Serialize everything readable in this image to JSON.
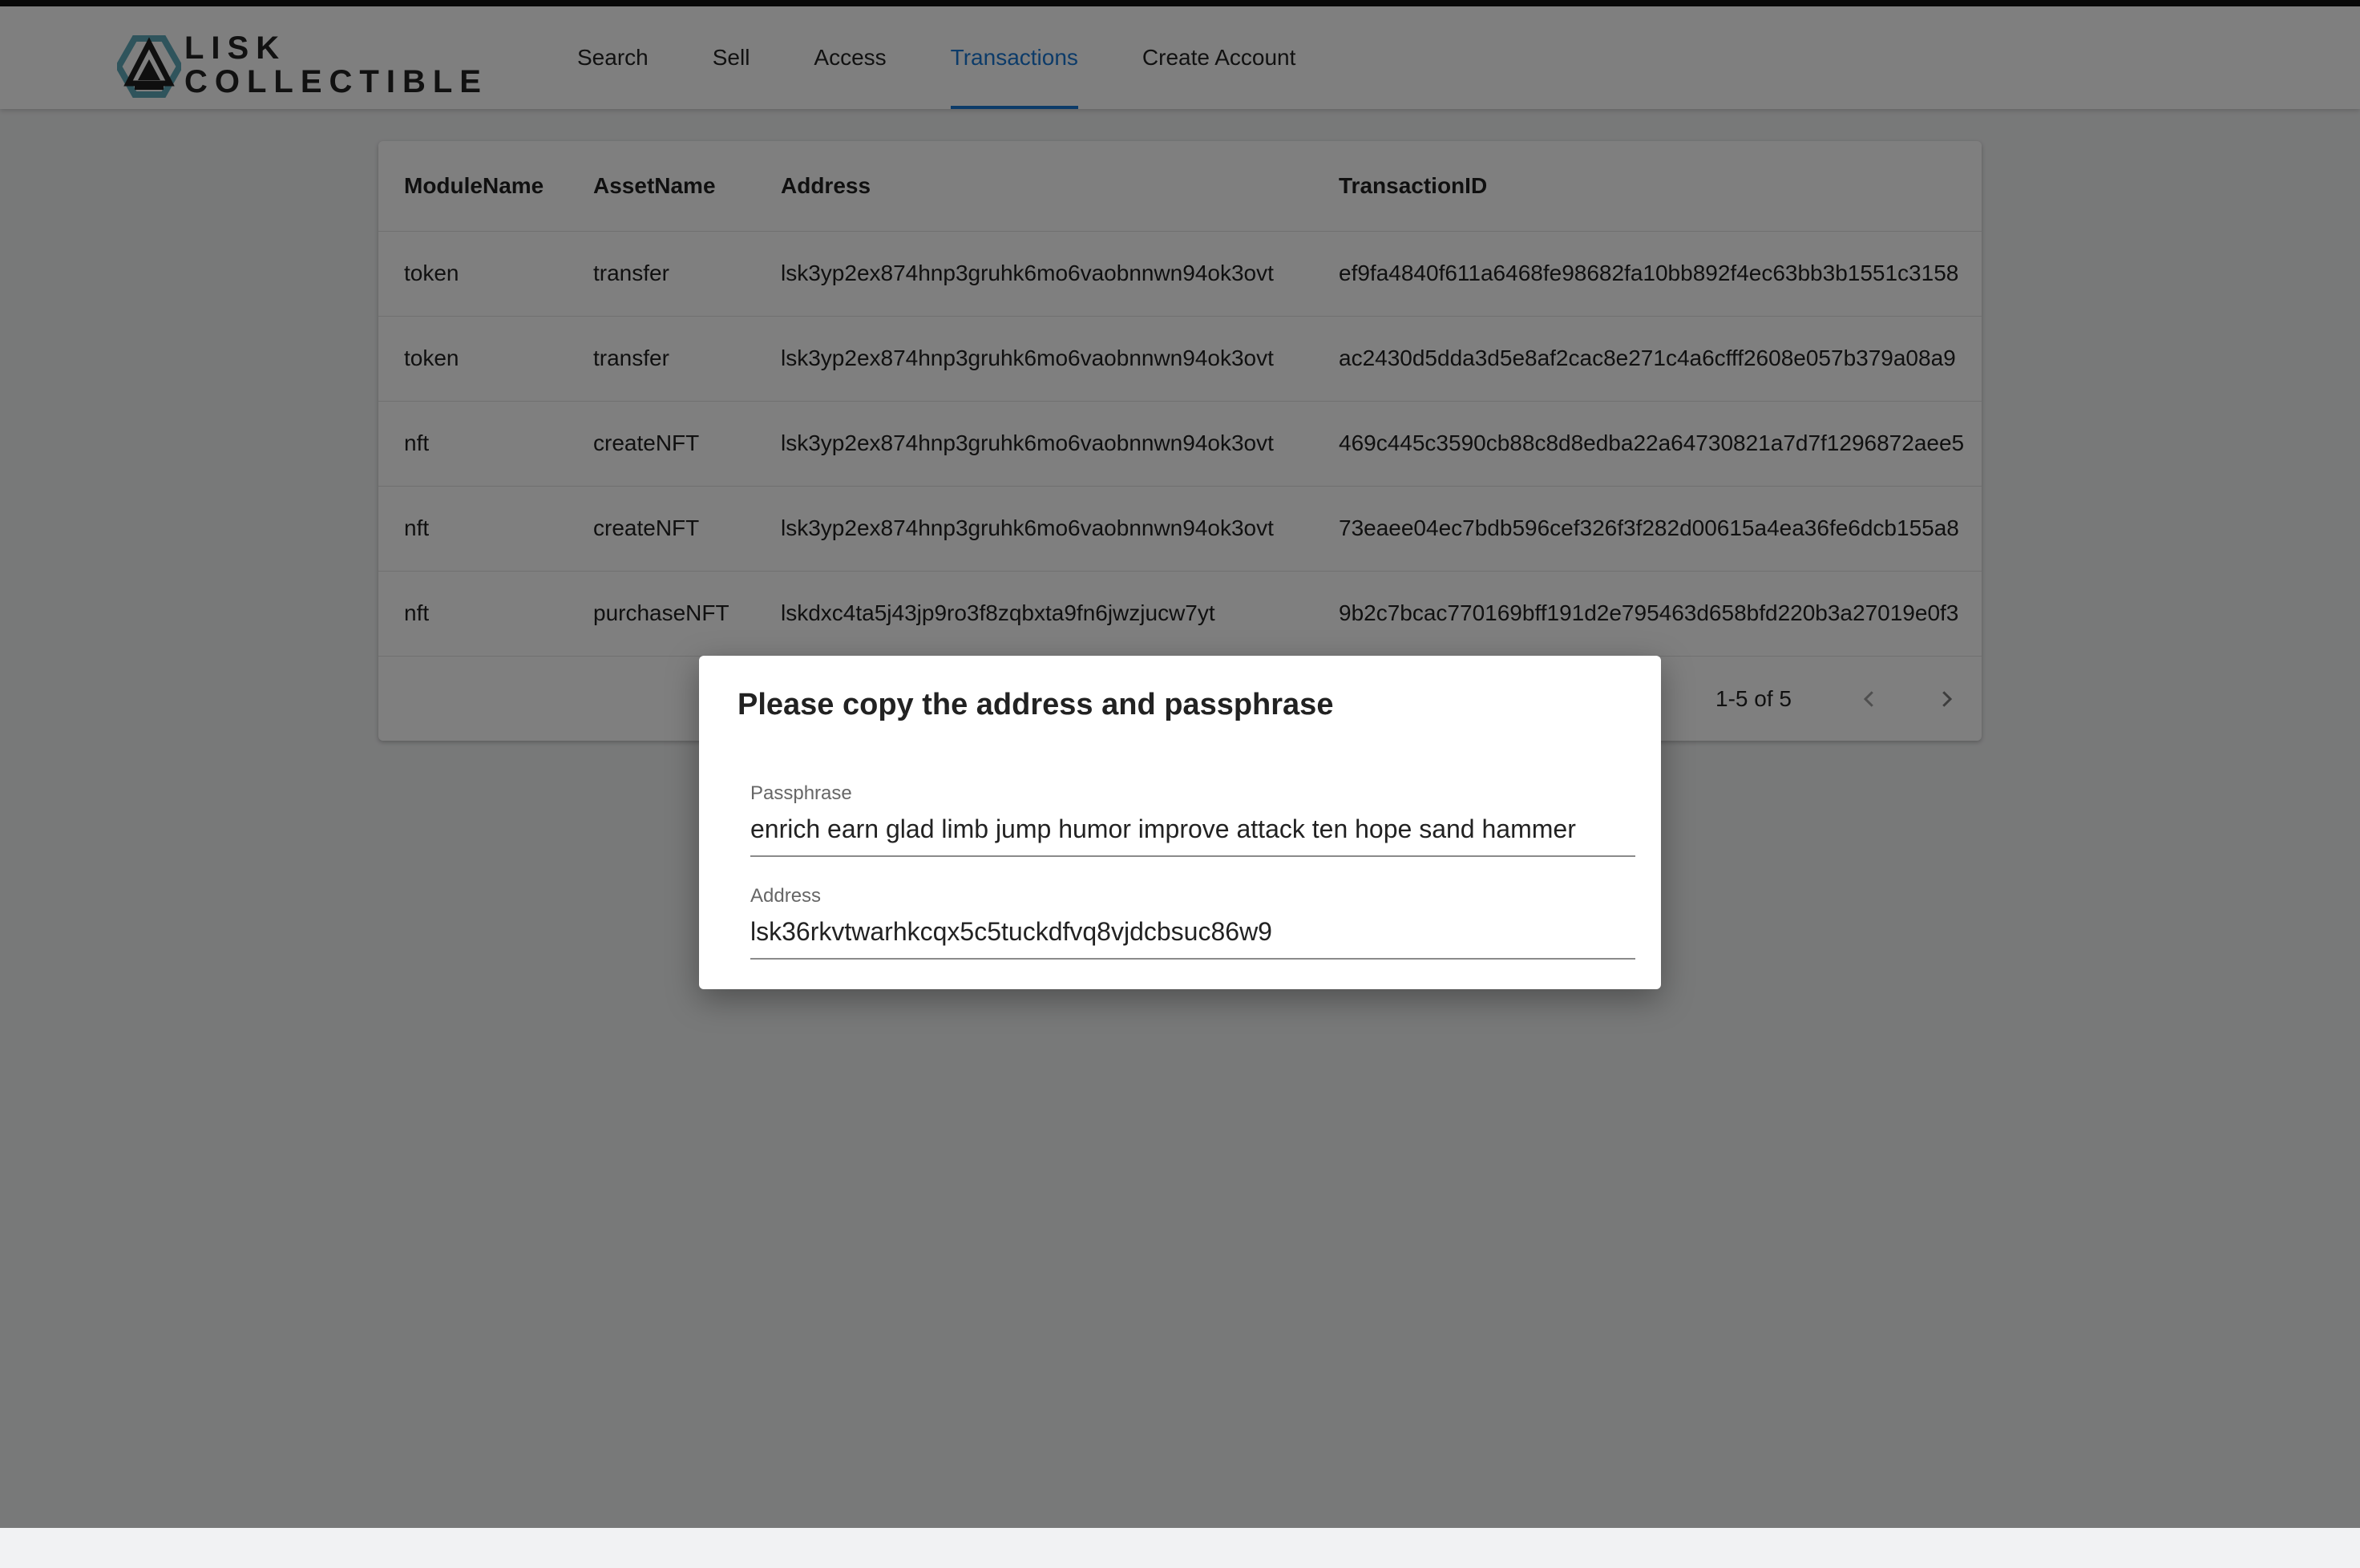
{
  "logo": {
    "line1": "LISK",
    "line2": "COLLECTIBLE",
    "icon": "lisk-logo-icon"
  },
  "nav": {
    "tabs": [
      {
        "label": "Search"
      },
      {
        "label": "Sell"
      },
      {
        "label": "Access"
      },
      {
        "label": "Transactions",
        "active": true
      },
      {
        "label": "Create Account"
      }
    ],
    "accent_color": "#1976d2"
  },
  "table": {
    "columns": [
      "ModuleName",
      "AssetName",
      "Address",
      "TransactionID"
    ],
    "rows": [
      {
        "module": "token",
        "asset": "transfer",
        "address": "lsk3yp2ex874hnp3gruhk6mo6vaobnnwn94ok3ovt",
        "txid": "ef9fa4840f611a6468fe98682fa10bb892f4ec63bb3b1551c3158"
      },
      {
        "module": "token",
        "asset": "transfer",
        "address": "lsk3yp2ex874hnp3gruhk6mo6vaobnnwn94ok3ovt",
        "txid": "ac2430d5dda3d5e8af2cac8e271c4a6cfff2608e057b379a08a9"
      },
      {
        "module": "nft",
        "asset": "createNFT",
        "address": "lsk3yp2ex874hnp3gruhk6mo6vaobnnwn94ok3ovt",
        "txid": "469c445c3590cb88c8d8edba22a64730821a7d7f1296872aee5"
      },
      {
        "module": "nft",
        "asset": "createNFT",
        "address": "lsk3yp2ex874hnp3gruhk6mo6vaobnnwn94ok3ovt",
        "txid": "73eaee04ec7bdb596cef326f3f282d00615a4ea36fe6dcb155a8"
      },
      {
        "module": "nft",
        "asset": "purchaseNFT",
        "address": "lskdxc4ta5j43jp9ro3f8zqbxta9fn6jwzjucw7yt",
        "txid": "9b2c7bcac770169bff191d2e795463d658bfd220b3a27019e0f3"
      }
    ],
    "pagination": {
      "range": "1-5 of 5",
      "prev_icon": "chevron-left-icon",
      "next_icon": "chevron-right-icon"
    }
  },
  "dialog": {
    "title": "Please copy the address and passphrase",
    "passphrase_label": "Passphrase",
    "passphrase_value": "enrich earn glad limb jump humor improve attack ten hope sand hammer",
    "address_label": "Address",
    "address_value": "lsk36rkvtwarhkcqx5c5tuckdfvq8vjdcbsuc86w9"
  }
}
